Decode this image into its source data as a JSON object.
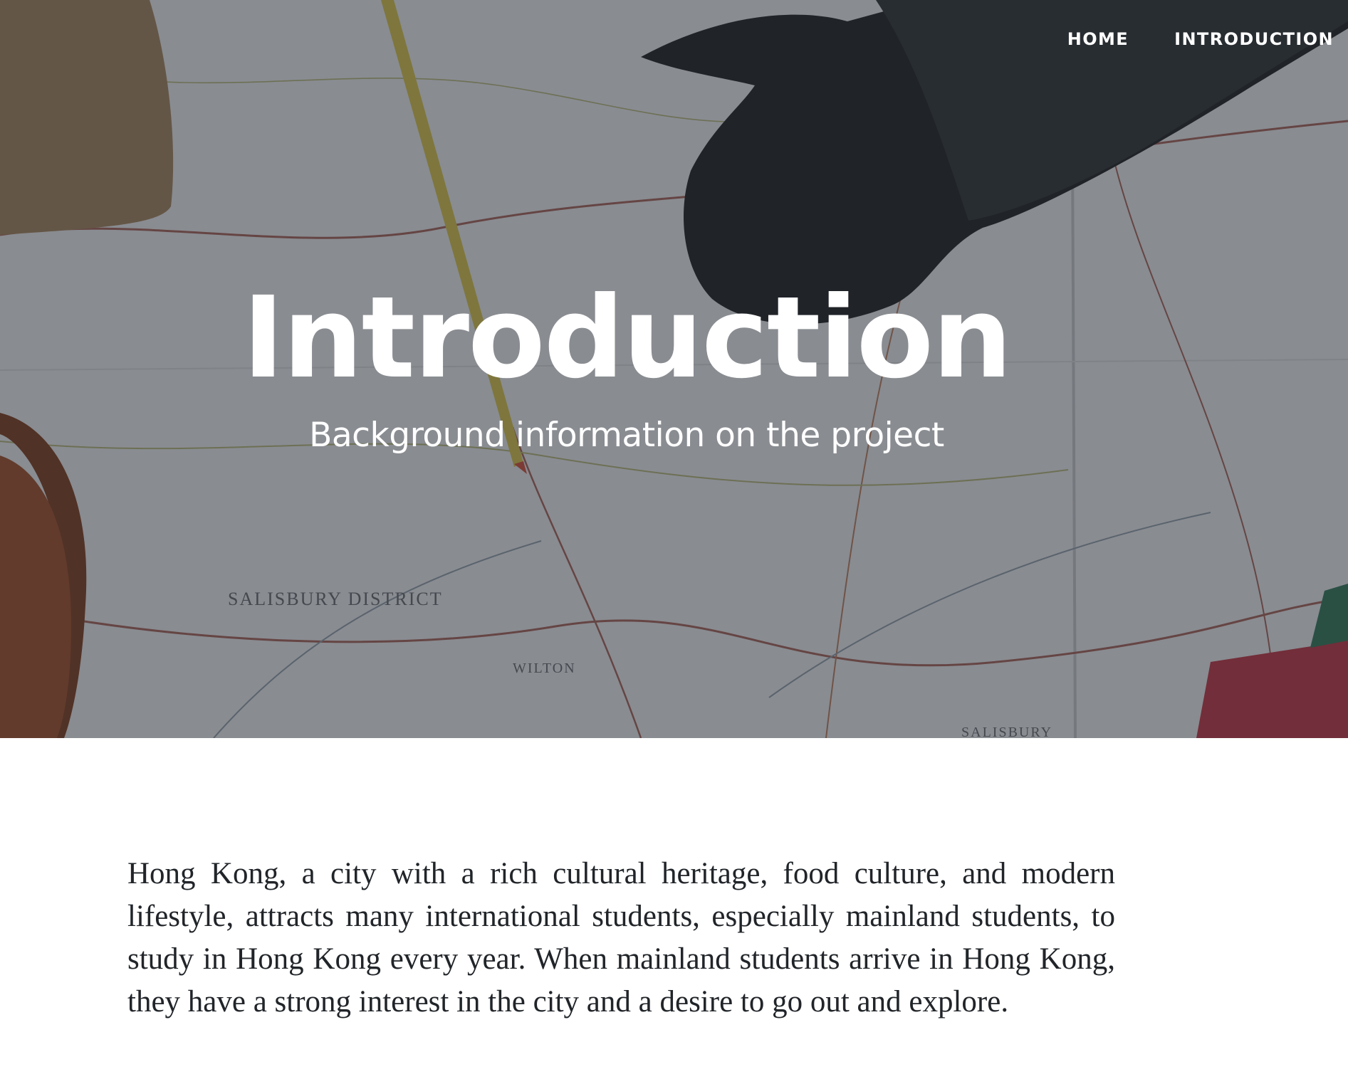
{
  "nav": {
    "items": [
      {
        "label": "HOME"
      },
      {
        "label": "INTRODUCTION"
      }
    ]
  },
  "hero": {
    "background": "map-photo-with-camera-pencil-bag",
    "title": "Introduction",
    "subtitle": "Background information on the project",
    "map_labels": [
      "SALISBURY DISTRICT",
      "WILTON",
      "SALISBURY"
    ]
  },
  "content": {
    "paragraph": "Hong Kong, a city with a rich cultural heritage, food culture, and modern lifestyle, attracts many international students, especially mainland students, to study in Hong Kong every year. When mainland students arrive in Hong Kong, they have a strong interest in the city and a desire to go out and explore."
  },
  "colors": {
    "overlay": "#212529",
    "text_on_hero": "#ffffff",
    "body_text": "#212529"
  }
}
